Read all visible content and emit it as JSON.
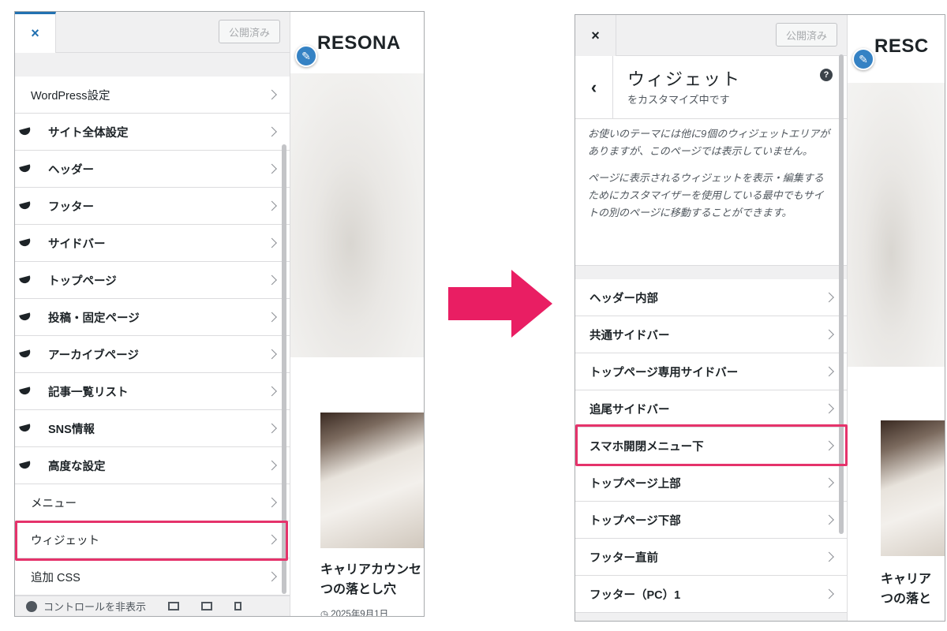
{
  "colors": {
    "highlight": "#e5336b",
    "arrow": "#e91e63",
    "wp_blue": "#2271b1"
  },
  "left": {
    "close_icon": "×",
    "publish_label": "公開済み",
    "items": [
      {
        "label": "WordPress設定"
      },
      {
        "label": "サイト全体設定"
      },
      {
        "label": "ヘッダー"
      },
      {
        "label": "フッター"
      },
      {
        "label": "サイドバー"
      },
      {
        "label": "トップページ"
      },
      {
        "label": "投稿・固定ページ"
      },
      {
        "label": "アーカイブページ"
      },
      {
        "label": "記事一覧リスト"
      },
      {
        "label": "SNS情報"
      },
      {
        "label": "高度な設定"
      },
      {
        "label": "メニュー"
      },
      {
        "label": "ウィジェット"
      },
      {
        "label": "追加 CSS"
      }
    ],
    "footer_text": "コントロールを非表示",
    "preview": {
      "site_title": "RESONA",
      "post_title_1": "キャリアカウンセ",
      "post_title_2": "つの落とし穴",
      "post_date": "◷ 2025年9月1日"
    }
  },
  "right": {
    "close_icon": "×",
    "publish_label": "公開済み",
    "back_icon": "‹",
    "section_title": "ウィジェット",
    "section_subtitle": "をカスタマイズ中です",
    "help_icon": "?",
    "desc_1": "お使いのテーマには他に9個のウィジェットエリアがありますが、このページでは表示していません。",
    "desc_2": "ページに表示されるウィジェットを表示・編集するためにカスタマイザーを使用している最中でもサイトの別のページに移動することができます。",
    "items": [
      {
        "label": "ヘッダー内部"
      },
      {
        "label": "共通サイドバー"
      },
      {
        "label": "トップページ専用サイドバー"
      },
      {
        "label": "追尾サイドバー"
      },
      {
        "label": "スマホ開閉メニュー下"
      },
      {
        "label": "トップページ上部"
      },
      {
        "label": "トップページ下部"
      },
      {
        "label": "フッター直前"
      },
      {
        "label": "フッター（PC）1"
      }
    ],
    "preview": {
      "site_title": "RESC",
      "post_title_1": "キャリア",
      "post_title_2": "つの落と"
    }
  }
}
